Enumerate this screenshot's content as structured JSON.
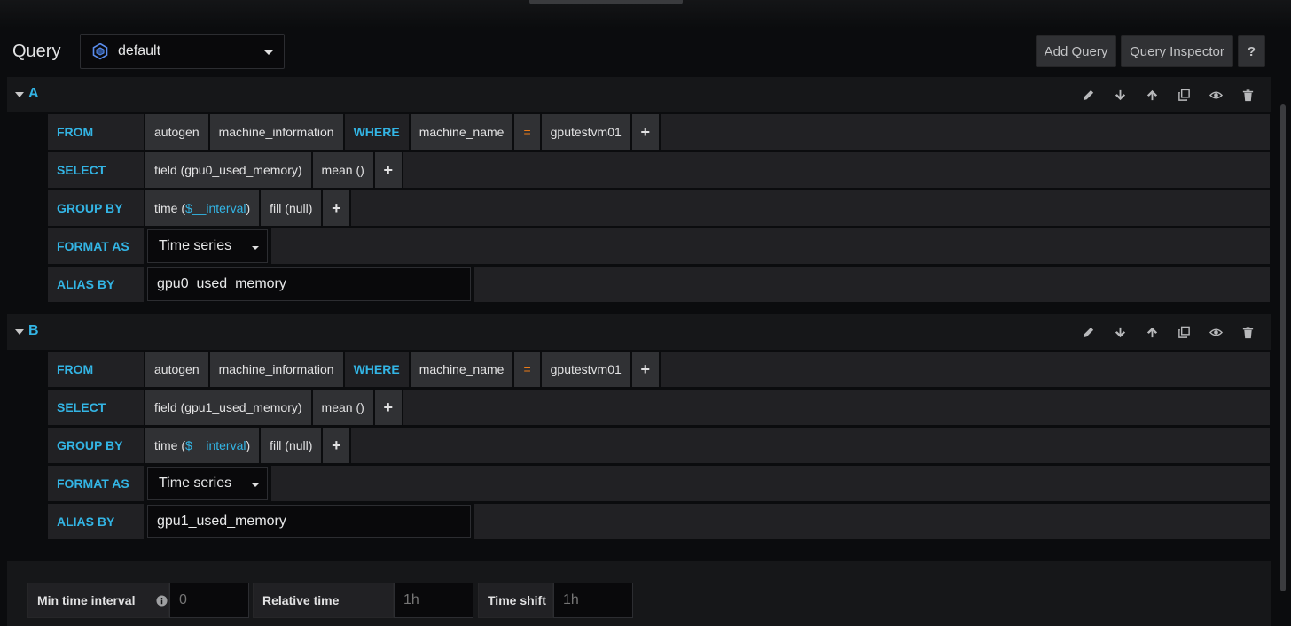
{
  "header": {
    "title": "Query",
    "datasource": "default",
    "add_query": "Add Query",
    "inspector": "Query Inspector",
    "help": "?"
  },
  "queries": [
    {
      "ref": "A",
      "from": {
        "label": "FROM",
        "policy": "autogen",
        "measurement": "machine_information",
        "where": "WHERE",
        "tag": "machine_name",
        "operator": "=",
        "value": "gputestvm01"
      },
      "select": {
        "label": "SELECT",
        "field": "field (gpu0_used_memory)",
        "agg": "mean ()"
      },
      "group_by": {
        "label": "GROUP BY",
        "time_pre": "time (",
        "time_var": "$__interval",
        "time_post": ")",
        "fill": "fill (null)"
      },
      "format_as": {
        "label": "FORMAT AS",
        "value": "Time series"
      },
      "alias_by": {
        "label": "ALIAS BY",
        "value": "gpu0_used_memory"
      }
    },
    {
      "ref": "B",
      "from": {
        "label": "FROM",
        "policy": "autogen",
        "measurement": "machine_information",
        "where": "WHERE",
        "tag": "machine_name",
        "operator": "=",
        "value": "gputestvm01"
      },
      "select": {
        "label": "SELECT",
        "field": "field (gpu1_used_memory)",
        "agg": "mean ()"
      },
      "group_by": {
        "label": "GROUP BY",
        "time_pre": "time (",
        "time_var": "$__interval",
        "time_post": ")",
        "fill": "fill (null)"
      },
      "format_as": {
        "label": "FORMAT AS",
        "value": "Time series"
      },
      "alias_by": {
        "label": "ALIAS BY",
        "value": "gpu1_used_memory"
      }
    }
  ],
  "plus": "+",
  "options": {
    "min_interval_label": "Min time interval",
    "min_interval_placeholder": "0",
    "relative_label": "Relative time",
    "relative_placeholder": "1h",
    "shift_label": "Time shift",
    "shift_placeholder": "1h"
  },
  "icons": [
    "datasource-icon",
    "pencil-icon",
    "arrow-down-icon",
    "arrow-up-icon",
    "duplicate-icon",
    "eye-icon",
    "trash-icon",
    "info-icon"
  ],
  "colors": {
    "accent": "#33b5e5",
    "operator": "#eb7b18"
  }
}
